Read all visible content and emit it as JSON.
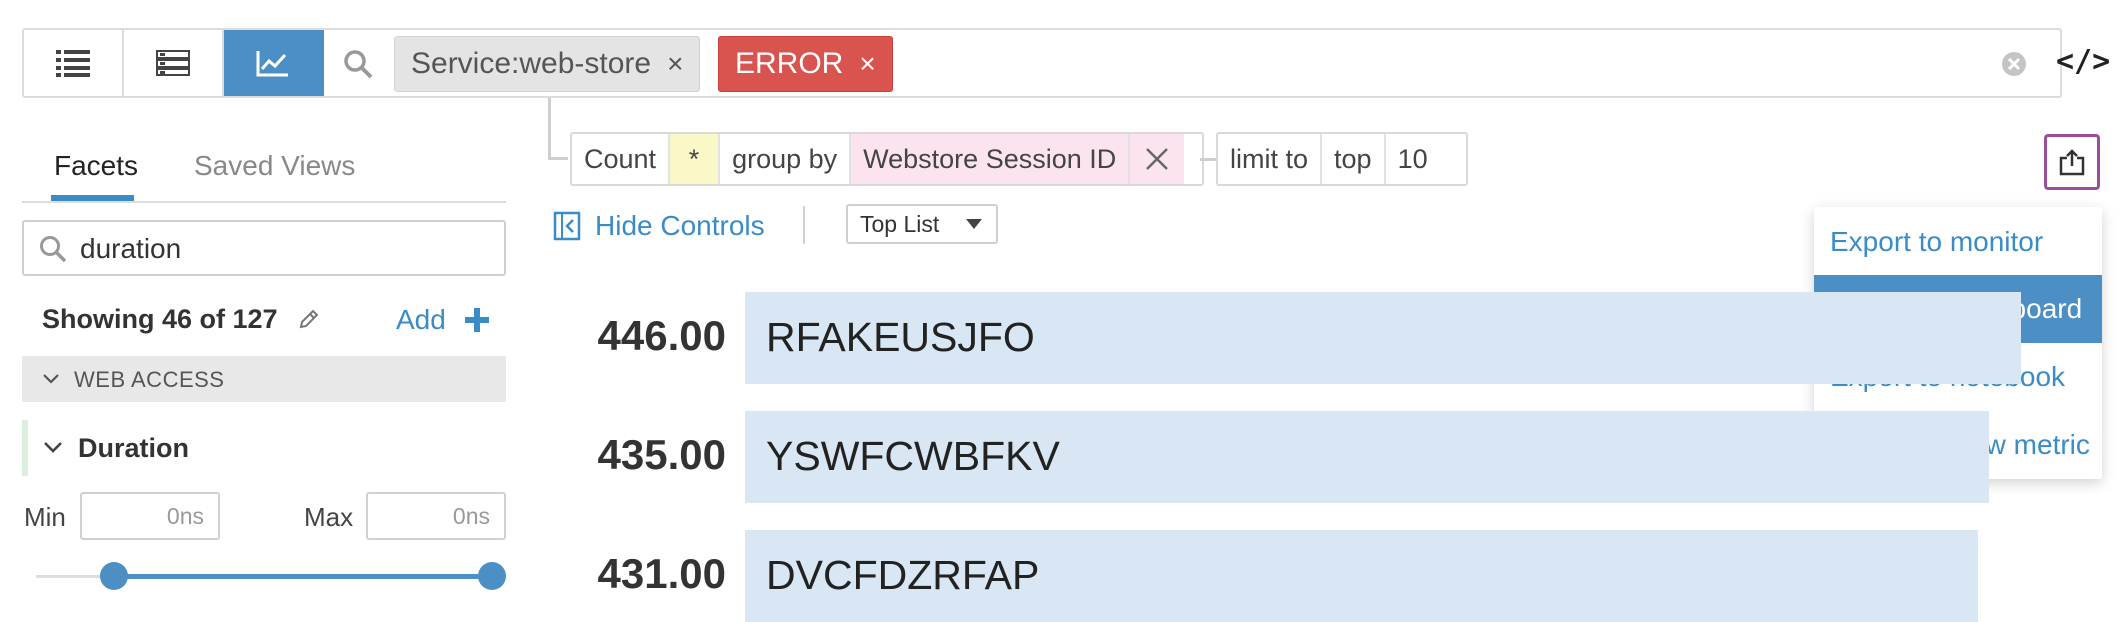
{
  "search": {
    "tags": [
      {
        "label": "Service:web-store",
        "close": "×"
      },
      {
        "label": "ERROR",
        "close": "×"
      }
    ],
    "code_toggle": "</>"
  },
  "query": {
    "measure": "Count",
    "field": "*",
    "group_by_label": "group by",
    "group_by_value": "Webstore Session ID",
    "limit_label": "limit to",
    "limit_mode": "top",
    "limit_value": "10"
  },
  "controls": {
    "hide_label": "Hide Controls",
    "visualization": "Top List"
  },
  "export_menu": {
    "items": [
      "Export to monitor",
      "Export to dashboard",
      "Export to notebook",
      "Generate new metric"
    ],
    "highlighted": 1
  },
  "toplist": {
    "rows": [
      {
        "value": "446.00",
        "label": "RFAKEUSJFO",
        "fraction": 1.0
      },
      {
        "value": "435.00",
        "label": "YSWFCWBFKV",
        "fraction": 0.975
      },
      {
        "value": "431.00",
        "label": "DVCFDZRFAP",
        "fraction": 0.966
      }
    ]
  },
  "sidebar": {
    "tabs": [
      "Facets",
      "Saved Views"
    ],
    "active_tab": 0,
    "search_value": "duration",
    "showing": "Showing 46 of 127",
    "add_label": "Add",
    "group_label": "WEB ACCESS",
    "facet_title": "Duration",
    "min_label": "Min",
    "max_label": "Max",
    "min_value": "0ns",
    "max_value": "0ns"
  },
  "colors": {
    "accent": "#4b8fc4",
    "error": "#d9534f",
    "bar": "#d8e7f3"
  }
}
